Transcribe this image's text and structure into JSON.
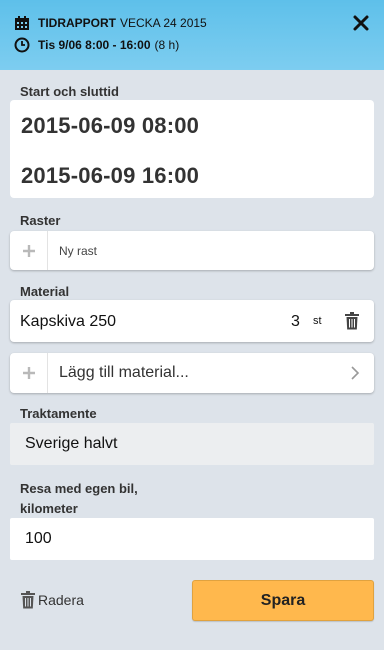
{
  "header": {
    "title_bold": "TIDRAPPORT",
    "title_rest": "VECKA 24 2015",
    "subtitle_bold": "Tis 9/06 8:00 - 16:00",
    "subtitle_rest": "(8 h)",
    "icons": [
      "calendar-icon",
      "clock-icon",
      "close-icon"
    ]
  },
  "times": {
    "label": "Start och sluttid",
    "start": "2015-06-09 08:00",
    "end": "2015-06-09 16:00"
  },
  "breaks": {
    "label": "Raster",
    "add_label": "Ny rast"
  },
  "material": {
    "label": "Material",
    "items": [
      {
        "name": "Kapskiva 250",
        "quantity": "3",
        "unit": "st"
      }
    ],
    "add_label": "Lägg till material..."
  },
  "allowance": {
    "label": "Traktamente",
    "value": "Sverige halvt"
  },
  "car": {
    "label_line1": "Resa med egen bil,",
    "label_line2": "kilometer",
    "value": "100"
  },
  "footer": {
    "delete_label": "Radera",
    "save_label": "Spara"
  },
  "colors": {
    "header_bg": "#5ec0ea",
    "page_bg": "#dde3ea",
    "save_bg": "#ffb84d"
  }
}
